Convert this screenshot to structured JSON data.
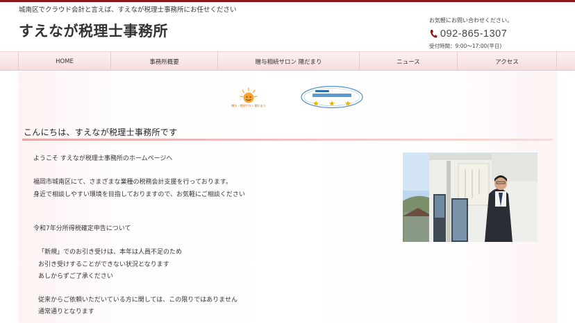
{
  "header": {
    "tagline": "城南区でクラウド会計と言えば、すえなが税理士事務所にお任せください",
    "site_title": "すえなが税理士事務所",
    "contact_lead": "お気軽にお問い合わせください。",
    "phone": "092-865-1307",
    "hours": "受付時間：9:00～17:00(平日)"
  },
  "nav": {
    "items": [
      {
        "label": "HOME"
      },
      {
        "label": "事務所概要"
      },
      {
        "label": "贈与相続サロン 陽だまり"
      },
      {
        "label": "ニュース"
      },
      {
        "label": "アクセス"
      }
    ]
  },
  "banners": {
    "sun_caption": "贈与・相続サロン 陽だまり"
  },
  "main": {
    "heading": "こんにちは、すえなが税理士事務所です",
    "welcome": "ようこそ すえなが税理士事務所のホームページへ",
    "para1_line1": "福岡市城南区にて、さまざまな業種の税務会計支援を行っております。",
    "para1_line2": "身近で相談しやすい環境を目指しておりますので、お気軽にご相談ください",
    "notice_title": "令和7年分所得税確定申告について",
    "notice_line1": "「新規」でのお引き受けは、本年は人員不足のため",
    "notice_line2": "お引き受けすることができない状況となります",
    "notice_line3": "あしからずご了承ください",
    "notice_line4": "従来からご依頼いただいている方に関しては、この限りではありません",
    "notice_line5": "通常通りとなります"
  },
  "colors": {
    "accent_dark_red": "#8b1a1a",
    "nav_bg": "#f6dcdc",
    "heading_rule": "#e9a6a6"
  }
}
